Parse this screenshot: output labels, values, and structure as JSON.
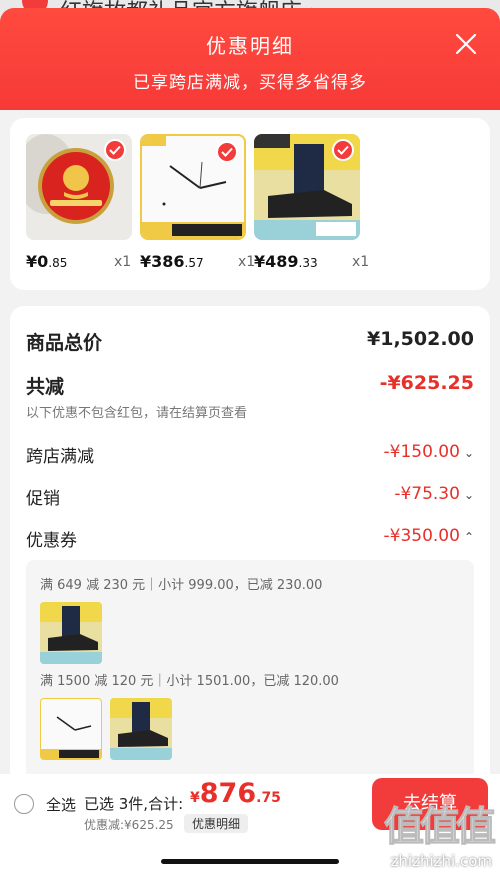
{
  "behind_title": "红旗故都礼品官方旗舰店 ›",
  "header": {
    "title": "优惠明细",
    "subtitle": "已享跨店满减，买得多省得多"
  },
  "products": [
    {
      "price_int": "¥0",
      "price_dec": ".85",
      "qty": "x1",
      "image": "red-badge-pin"
    },
    {
      "price_int": "¥386",
      "price_dec": ".57",
      "qty": "x1",
      "image": "nswr-wall-clock"
    },
    {
      "price_int": "¥489",
      "price_dec": ".33",
      "qty": "x1",
      "image": "timberland-shoes"
    }
  ],
  "summary": {
    "total_label": "商品总价",
    "total_value": "¥1,502.00",
    "reduce_label": "共减",
    "reduce_value": "-¥625.25",
    "note": "以下优惠不包含红包，请在结算页查看",
    "items": [
      {
        "label": "跨店满减",
        "value": "-¥150.00",
        "chevron": "down"
      },
      {
        "label": "促销",
        "value": "-¥75.30",
        "chevron": "down"
      },
      {
        "label": "优惠券",
        "value": "-¥350.00",
        "chevron": "up"
      }
    ]
  },
  "coupons": [
    {
      "text": "满 649 减 230 元｜小计 999.00，已减 230.00"
    },
    {
      "text": "满 1500 减 120 元｜小计 1501.00，已减 120.00"
    }
  ],
  "bottom": {
    "select_all": "全选",
    "selected": "已选 3件,合计:",
    "currency": "¥",
    "amount_int": "876",
    "amount_dec": ".75",
    "discount": "优惠减:¥625.25",
    "detail_button": "优惠明细",
    "checkout": "去结算"
  },
  "watermark": {
    "glyphs": "值值值",
    "url": "zhizhizhi.com"
  },
  "colors": {
    "accent": "#f23c3c",
    "discount": "#e8302a"
  }
}
